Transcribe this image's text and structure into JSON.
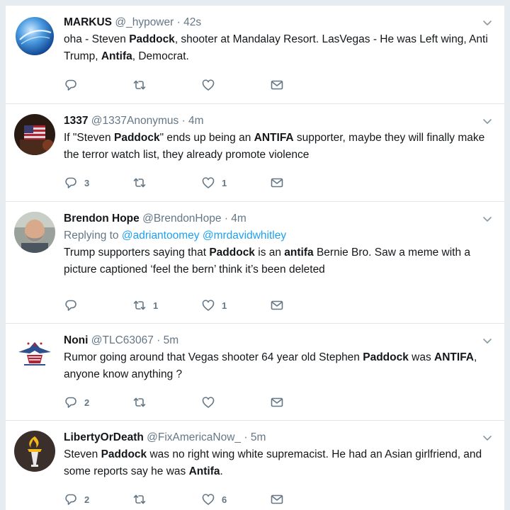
{
  "colors": {
    "page_background": "#e6ecf0",
    "card_background": "#ffffff",
    "text_primary": "#14171a",
    "text_secondary": "#657786",
    "link": "#1da1f2",
    "divider": "#e1e8ed"
  },
  "icons": {
    "reply": "reply-icon",
    "retweet": "retweet-icon",
    "like": "heart-icon",
    "dm": "envelope-icon",
    "menu": "chevron-down-icon"
  },
  "tweets": [
    {
      "name": "MARKUS",
      "handle": "@_hypower",
      "sep": "·",
      "time": "42s",
      "text": [
        {
          "t": "oha   -   Steven "
        },
        {
          "t": "Paddock",
          "b": true
        },
        {
          "t": ", shooter at Mandalay Resort. LasVegas - He was Left wing, Anti Trump, "
        },
        {
          "t": "Antifa",
          "b": true
        },
        {
          "t": ", Democrat."
        }
      ],
      "replies": "",
      "retweets": "",
      "likes": ""
    },
    {
      "name": "1337",
      "handle": "@1337Anonymus",
      "sep": "·",
      "time": "4m",
      "text": [
        {
          "t": "If \"Steven "
        },
        {
          "t": "Paddock",
          "b": true
        },
        {
          "t": "\" ends up being an "
        },
        {
          "t": "ANTIFA",
          "b": true
        },
        {
          "t": " supporter, maybe they will finally make the terror watch list, they already promote violence"
        }
      ],
      "replies": "3",
      "retweets": "",
      "likes": "1"
    },
    {
      "name": "Brendon Hope",
      "handle": "@BrendonHope",
      "sep": "·",
      "time": "4m",
      "replying_label": "Replying to",
      "replying_to": [
        "@adriantoomey",
        "@mrdavidwhitley"
      ],
      "text": [
        {
          "t": "Trump supporters saying that "
        },
        {
          "t": "Paddock",
          "b": true
        },
        {
          "t": " is an "
        },
        {
          "t": "antifa",
          "b": true
        },
        {
          "t": " Bernie Bro. Saw a meme with a picture captioned ‘feel the bern’ think it’s been deleted"
        }
      ],
      "replies": "",
      "retweets": "1",
      "likes": "1"
    },
    {
      "name": "Noni",
      "handle": "@TLC63067",
      "sep": "·",
      "time": "5m",
      "text": [
        {
          "t": "Rumor going around that Vegas shooter 64 year old Stephen "
        },
        {
          "t": "Paddock",
          "b": true
        },
        {
          "t": " was "
        },
        {
          "t": "ANTIFA",
          "b": true
        },
        {
          "t": ", anyone know anything ?"
        }
      ],
      "replies": "2",
      "retweets": "",
      "likes": ""
    },
    {
      "name": "LibertyOrDeath",
      "handle": "@FixAmericaNow_",
      "sep": "·",
      "time": "5m",
      "text": [
        {
          "t": "Steven "
        },
        {
          "t": "Paddock",
          "b": true
        },
        {
          "t": " was no right wing white supremacist. He had an Asian girlfriend, and some reports say he was "
        },
        {
          "t": "Antifa",
          "b": true
        },
        {
          "t": "."
        }
      ],
      "replies": "2",
      "retweets": "",
      "likes": "6"
    }
  ]
}
